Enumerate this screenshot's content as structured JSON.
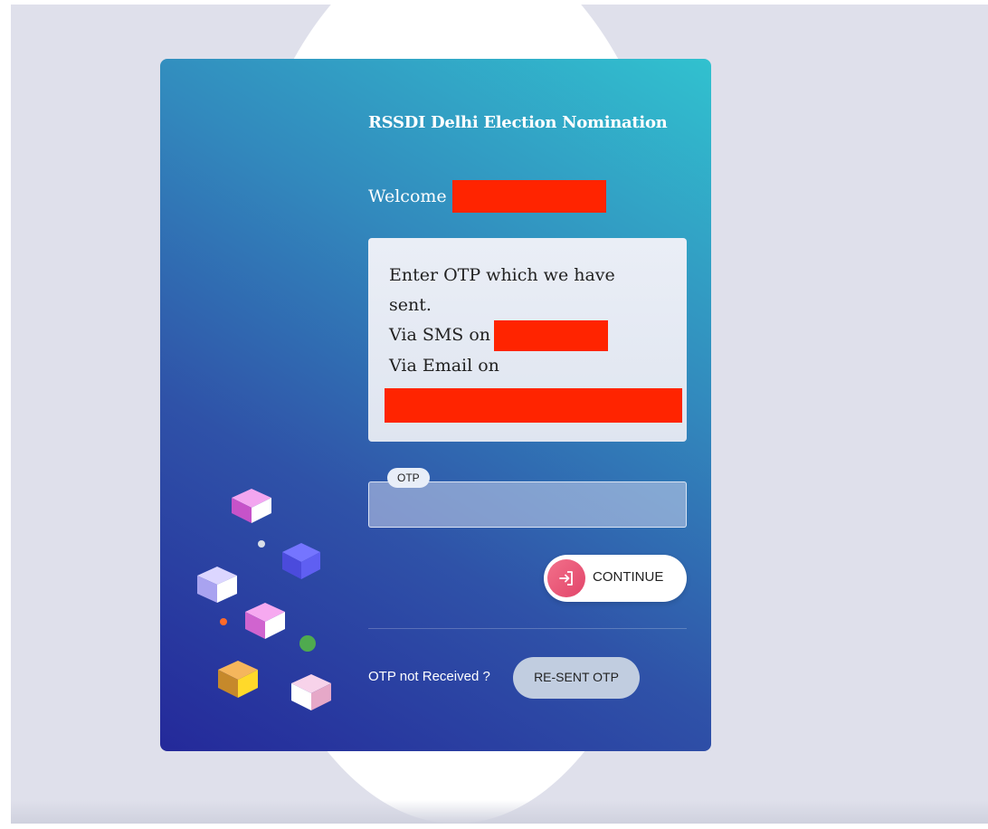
{
  "card": {
    "title": "RSSDI Delhi Election Nomination",
    "welcome_label": "Welcome"
  },
  "otp_message": {
    "line1": "Enter OTP which we have sent.",
    "line2": "Via SMS on",
    "line3": "Via Email on"
  },
  "otp_field": {
    "label": "OTP",
    "value": ""
  },
  "continue_button": {
    "label": "CONTINUE",
    "icon": "login-icon"
  },
  "resend": {
    "prompt": "OTP not Received ?",
    "button_label": "RE-SENT OTP"
  },
  "colors": {
    "card_gradient_start": "#24299a",
    "card_gradient_end": "#31c1cf",
    "redaction": "#ff2400",
    "continue_icon_bg": "#e2456a",
    "page_background": "#dfe0eb"
  }
}
